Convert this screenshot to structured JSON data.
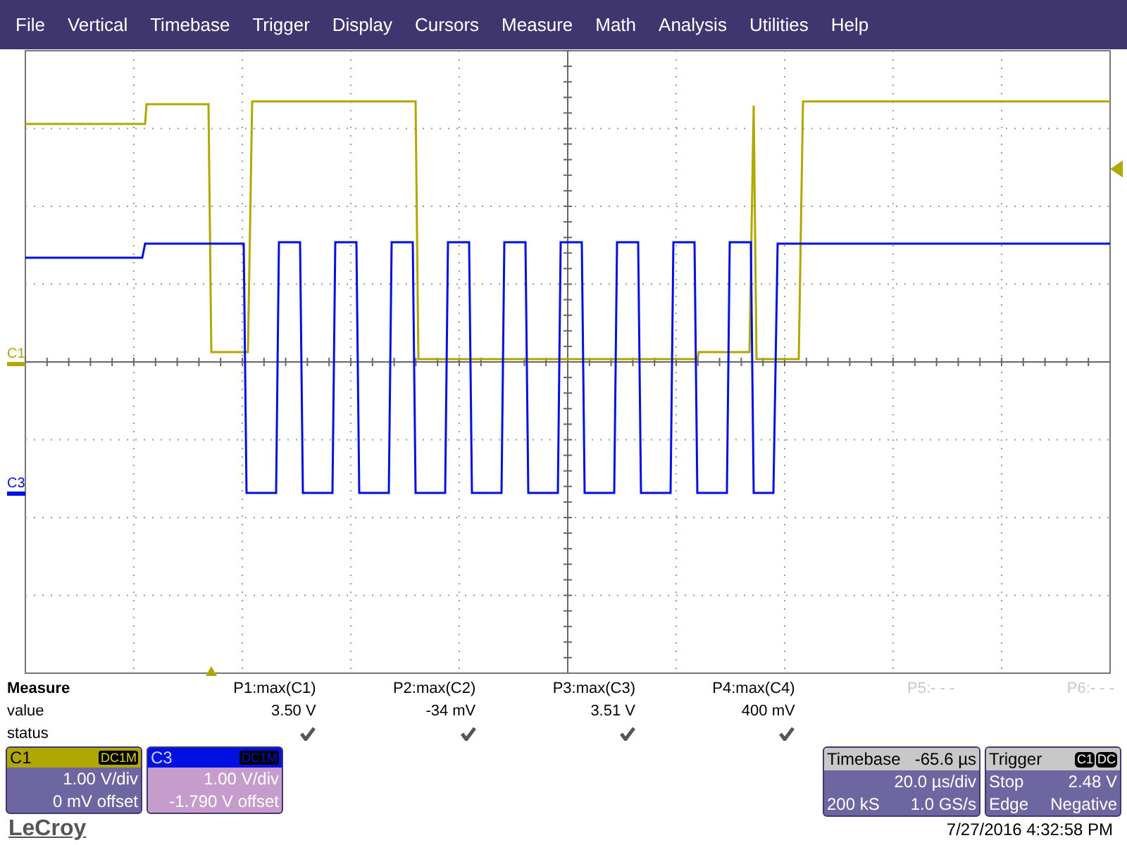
{
  "menu": [
    "File",
    "Vertical",
    "Timebase",
    "Trigger",
    "Display",
    "Cursors",
    "Measure",
    "Math",
    "Analysis",
    "Utilities",
    "Help"
  ],
  "traces": [
    {
      "label": "C1",
      "color": "#b0a800"
    },
    {
      "label": "C3",
      "color": "#0010e0"
    }
  ],
  "measure": {
    "title": "Measure",
    "row_labels": [
      "value",
      "status"
    ],
    "params": [
      {
        "name": "P1:max(C1)",
        "value": "3.50 V",
        "checked": true,
        "disabled": false
      },
      {
        "name": "P2:max(C2)",
        "value": "-34 mV",
        "checked": true,
        "disabled": false
      },
      {
        "name": "P3:max(C3)",
        "value": "3.51 V",
        "checked": true,
        "disabled": false
      },
      {
        "name": "P4:max(C4)",
        "value": "400 mV",
        "checked": true,
        "disabled": false
      },
      {
        "name": "P5:- - -",
        "checked": false,
        "disabled": true
      },
      {
        "name": "P6:- - -",
        "checked": false,
        "disabled": true
      }
    ]
  },
  "channels": [
    {
      "label": "C1",
      "coupling": "DC1M",
      "scale": "1.00 V/div",
      "offset": "0 mV offset",
      "color": "#b0a800",
      "selected": false
    },
    {
      "label": "C3",
      "coupling": "DC1M",
      "scale": "1.00 V/div",
      "offset": "-1.790 V offset",
      "color": "#0010e0",
      "selected": true
    }
  ],
  "timebase": {
    "title": "Timebase",
    "delay": "-65.6 µs",
    "scale": "20.0 µs/div",
    "samples": "200 kS",
    "rate": "1.0 GS/s"
  },
  "trigger": {
    "title": "Trigger",
    "source": "C1",
    "coupling": "DC",
    "mode": "Stop",
    "level": "2.48 V",
    "type": "Edge",
    "slope": "Negative"
  },
  "logo": "LeCroy",
  "timestamp": "7/27/2016 4:32:58 PM"
}
